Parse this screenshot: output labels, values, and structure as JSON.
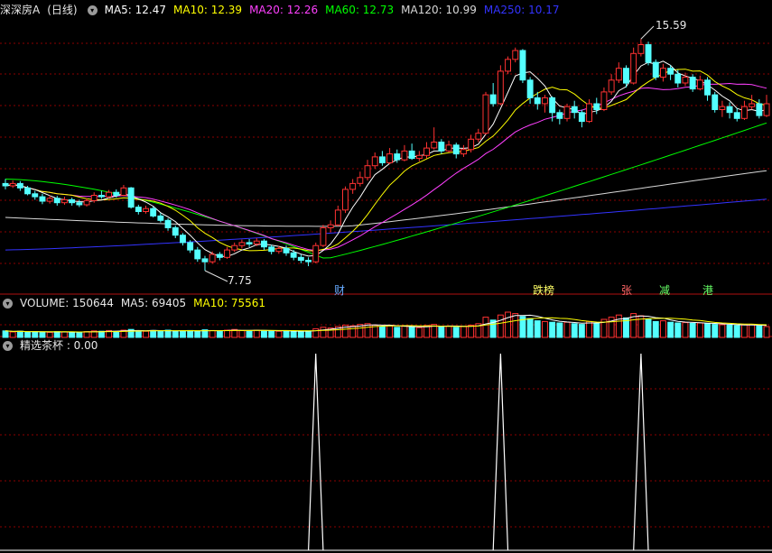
{
  "main_header": {
    "title": "深深房A",
    "period": "(日线)",
    "ma": [
      {
        "label": "MA5: 12.47",
        "color": "#ffffff"
      },
      {
        "label": "MA10: 12.39",
        "color": "#ffff00"
      },
      {
        "label": "MA20: 12.26",
        "color": "#ff40ff"
      },
      {
        "label": "MA60: 12.73",
        "color": "#00ff00"
      },
      {
        "label": "MA120: 10.99",
        "color": "#d8d8d8"
      },
      {
        "label": "MA250: 10.17",
        "color": "#3333ff"
      }
    ]
  },
  "volume_header": {
    "volume": "VOLUME: 150644",
    "ma5": "MA5: 69405",
    "ma10": "MA10: 75561"
  },
  "indicator_header": {
    "label": "精选茶杯 : 0.00"
  },
  "annotations": {
    "high": "15.59",
    "low": "7.75",
    "events": [
      {
        "text": "财",
        "color": "#66aaff"
      },
      {
        "text": "跌榜",
        "color": "#ffff66"
      },
      {
        "text": "张",
        "color": "#ff6666"
      },
      {
        "text": "减",
        "color": "#66ff66"
      },
      {
        "text": "港",
        "color": "#66ff66"
      }
    ]
  },
  "colors": {
    "up": "#ff3232",
    "down": "#54ffff",
    "grid": "#8b0000",
    "background": "#000000"
  },
  "chart_data": [
    {
      "type": "candlestick",
      "title": "深深房A (日线)",
      "price_range": [
        7.2,
        16.3
      ],
      "high_marker": 15.59,
      "low_marker": 7.75,
      "candles": [
        [
          10.7,
          10.62,
          10.85,
          10.5
        ],
        [
          10.62,
          10.7,
          10.8,
          10.55
        ],
        [
          10.7,
          10.55,
          10.78,
          10.45
        ],
        [
          10.55,
          10.35,
          10.62,
          10.3
        ],
        [
          10.35,
          10.25,
          10.45,
          10.15
        ],
        [
          10.25,
          10.1,
          10.35,
          10.0
        ],
        [
          10.1,
          10.2,
          10.3,
          10.02
        ],
        [
          10.2,
          10.05,
          10.28,
          9.95
        ],
        [
          10.05,
          10.15,
          10.25,
          9.98
        ],
        [
          10.15,
          10.05,
          10.22,
          9.95
        ],
        [
          10.05,
          9.98,
          10.15,
          9.9
        ],
        [
          9.98,
          10.12,
          10.2,
          9.92
        ],
        [
          10.12,
          10.3,
          10.4,
          10.05
        ],
        [
          10.3,
          10.25,
          10.45,
          10.18
        ],
        [
          10.25,
          10.4,
          10.48,
          10.2
        ],
        [
          10.4,
          10.3,
          10.5,
          10.22
        ],
        [
          10.3,
          10.55,
          10.65,
          10.28
        ],
        [
          10.55,
          9.9,
          10.58,
          9.85
        ],
        [
          9.9,
          9.75,
          9.98,
          9.65
        ],
        [
          9.75,
          9.85,
          9.95,
          9.68
        ],
        [
          9.85,
          9.6,
          9.92,
          9.55
        ],
        [
          9.6,
          9.45,
          9.7,
          9.38
        ],
        [
          9.45,
          9.2,
          9.52,
          9.1
        ],
        [
          9.2,
          8.95,
          9.28,
          8.85
        ],
        [
          8.95,
          8.7,
          9.02,
          8.6
        ],
        [
          8.7,
          8.45,
          8.78,
          8.35
        ],
        [
          8.45,
          8.15,
          8.55,
          8.05
        ],
        [
          8.15,
          8.05,
          8.25,
          7.75
        ],
        [
          8.05,
          8.3,
          8.4,
          7.98
        ],
        [
          8.3,
          8.2,
          8.38,
          8.1
        ],
        [
          8.2,
          8.45,
          8.55,
          8.15
        ],
        [
          8.45,
          8.6,
          8.7,
          8.38
        ],
        [
          8.6,
          8.7,
          8.8,
          8.5
        ],
        [
          8.7,
          8.65,
          8.82,
          8.55
        ],
        [
          8.65,
          8.75,
          8.85,
          8.58
        ],
        [
          8.75,
          8.55,
          8.82,
          8.45
        ],
        [
          8.55,
          8.4,
          8.62,
          8.3
        ],
        [
          8.4,
          8.5,
          8.58,
          8.32
        ],
        [
          8.5,
          8.35,
          8.6,
          8.25
        ],
        [
          8.35,
          8.2,
          8.45,
          8.1
        ],
        [
          8.2,
          8.1,
          8.3,
          8.0
        ],
        [
          8.1,
          8.05,
          8.2,
          7.9
        ],
        [
          8.05,
          8.6,
          8.7,
          8.0
        ],
        [
          8.6,
          9.2,
          9.3,
          8.55
        ],
        [
          9.2,
          9.3,
          9.45,
          9.05
        ],
        [
          9.3,
          9.8,
          9.95,
          9.25
        ],
        [
          9.8,
          10.5,
          10.6,
          9.7
        ],
        [
          10.5,
          10.7,
          10.85,
          10.35
        ],
        [
          10.7,
          10.9,
          11.1,
          10.6
        ],
        [
          10.9,
          11.3,
          11.5,
          10.8
        ],
        [
          11.3,
          11.6,
          11.75,
          11.2
        ],
        [
          11.6,
          11.4,
          11.8,
          11.3
        ],
        [
          11.4,
          11.7,
          11.9,
          11.35
        ],
        [
          11.7,
          11.5,
          11.85,
          11.4
        ],
        [
          11.5,
          11.8,
          12.0,
          11.45
        ],
        [
          11.8,
          11.55,
          12.05,
          11.5
        ],
        [
          11.55,
          11.65,
          11.8,
          11.45
        ],
        [
          11.65,
          11.9,
          12.1,
          11.55
        ],
        [
          11.9,
          12.1,
          12.6,
          11.85
        ],
        [
          12.1,
          11.8,
          12.2,
          11.7
        ],
        [
          11.8,
          12.0,
          12.15,
          11.75
        ],
        [
          12.0,
          11.7,
          12.08,
          11.55
        ],
        [
          11.7,
          11.85,
          12.0,
          11.6
        ],
        [
          11.85,
          12.2,
          12.35,
          11.75
        ],
        [
          12.2,
          12.4,
          12.55,
          12.1
        ],
        [
          12.4,
          13.7,
          13.8,
          12.35
        ],
        [
          13.7,
          13.4,
          14.1,
          13.3
        ],
        [
          13.4,
          14.5,
          14.7,
          13.35
        ],
        [
          14.5,
          14.9,
          15.0,
          14.4
        ],
        [
          14.9,
          15.2,
          15.3,
          14.8
        ],
        [
          15.2,
          14.2,
          15.25,
          14.1
        ],
        [
          14.2,
          13.6,
          14.3,
          13.4
        ],
        [
          13.6,
          13.4,
          13.8,
          13.2
        ],
        [
          13.4,
          13.6,
          13.7,
          13.1
        ],
        [
          13.6,
          13.1,
          13.65,
          12.8
        ],
        [
          13.1,
          12.9,
          13.2,
          12.7
        ],
        [
          12.9,
          13.3,
          13.4,
          12.8
        ],
        [
          13.3,
          13.1,
          13.5,
          12.9
        ],
        [
          13.1,
          12.8,
          13.2,
          12.6
        ],
        [
          12.8,
          13.4,
          13.55,
          12.75
        ],
        [
          13.4,
          13.2,
          13.6,
          13.05
        ],
        [
          13.2,
          13.8,
          13.95,
          13.15
        ],
        [
          13.8,
          14.2,
          14.4,
          13.7
        ],
        [
          14.2,
          14.6,
          14.8,
          14.1
        ],
        [
          14.6,
          14.1,
          14.7,
          13.95
        ],
        [
          14.1,
          15.1,
          15.3,
          14.05
        ],
        [
          15.1,
          15.4,
          15.59,
          15.0
        ],
        [
          15.4,
          14.8,
          15.5,
          14.7
        ],
        [
          14.8,
          14.3,
          14.9,
          14.2
        ],
        [
          14.3,
          14.6,
          14.75,
          14.15
        ],
        [
          14.6,
          14.4,
          14.7,
          14.2
        ],
        [
          14.4,
          14.1,
          14.55,
          13.95
        ],
        [
          14.1,
          14.3,
          14.45,
          14.0
        ],
        [
          14.3,
          13.9,
          14.4,
          13.8
        ],
        [
          13.9,
          14.2,
          14.35,
          13.85
        ],
        [
          14.2,
          13.7,
          14.3,
          13.5
        ],
        [
          13.7,
          13.2,
          13.8,
          13.1
        ],
        [
          13.2,
          13.3,
          13.5,
          12.95
        ],
        [
          13.3,
          13.1,
          13.45,
          12.9
        ],
        [
          13.1,
          12.9,
          13.25,
          12.8
        ],
        [
          12.9,
          13.3,
          13.5,
          12.85
        ],
        [
          13.3,
          13.4,
          13.7,
          13.2
        ],
        [
          13.4,
          13.0,
          13.55,
          12.9
        ],
        [
          13.0,
          13.4,
          13.7,
          12.95
        ]
      ]
    },
    {
      "type": "bar",
      "title": "VOLUME",
      "values": [
        18,
        15,
        17,
        14,
        16,
        15,
        14,
        16,
        15,
        14,
        15,
        16,
        18,
        17,
        19,
        16,
        20,
        22,
        18,
        17,
        19,
        18,
        20,
        17,
        18,
        19,
        17,
        21,
        19,
        18,
        20,
        22,
        19,
        18,
        20,
        19,
        18,
        17,
        18,
        16,
        17,
        18,
        24,
        28,
        26,
        30,
        34,
        32,
        36,
        38,
        34,
        30,
        32,
        28,
        31,
        29,
        27,
        33,
        36,
        30,
        31,
        28,
        30,
        34,
        38,
        56,
        48,
        62,
        70,
        66,
        58,
        52,
        46,
        44,
        42,
        40,
        42,
        38,
        36,
        44,
        40,
        50,
        56,
        62,
        54,
        66,
        60,
        50,
        44,
        46,
        42,
        40,
        41,
        39,
        40,
        38,
        36,
        35,
        34,
        33,
        35,
        36,
        32,
        30
      ]
    },
    {
      "type": "line",
      "title": "精选茶杯",
      "spikes_at_index": [
        42,
        67,
        86
      ],
      "spike_value": 1.0,
      "ylim": [
        0,
        1.0
      ]
    }
  ]
}
